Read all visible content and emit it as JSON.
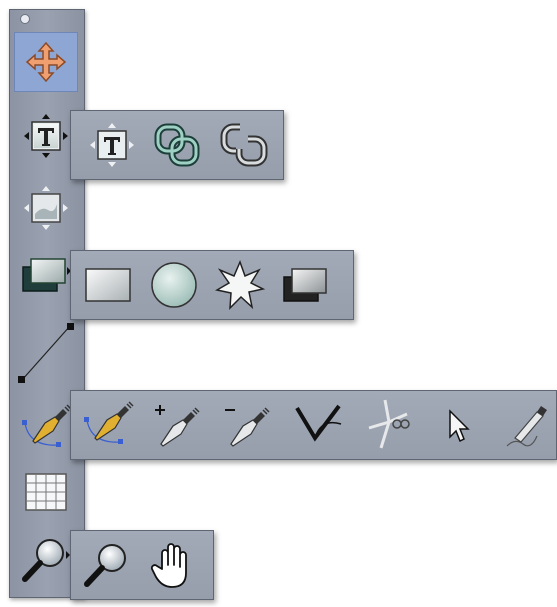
{
  "colors": {
    "toolbar_bg": "#9aa2b1",
    "flyout_bg": "#9ca4b2",
    "selected_bg": "#8ea6d4",
    "move_arrow": "#f0a070",
    "shape_fill": "#cbd6d6"
  },
  "toolbar": {
    "tools": [
      {
        "name": "move-tool",
        "icon": "four-way-arrow-icon",
        "selected": true
      },
      {
        "name": "text-box-tool",
        "icon": "text-box-icon",
        "has_flyout": true
      },
      {
        "name": "picture-box-tool",
        "icon": "picture-box-icon"
      },
      {
        "name": "shape-tool",
        "icon": "shape-stack-icon",
        "has_flyout": true
      },
      {
        "name": "line-tool",
        "icon": "line-icon"
      },
      {
        "name": "bezier-pen-tool",
        "icon": "pen-icon",
        "has_flyout": true
      },
      {
        "name": "table-tool",
        "icon": "table-icon"
      },
      {
        "name": "zoom-tool",
        "icon": "magnifier-icon",
        "has_flyout": true
      }
    ]
  },
  "flyouts": {
    "text": [
      "text-box-icon",
      "link-icon",
      "unlink-icon"
    ],
    "shapes": [
      "rectangle-icon",
      "oval-icon",
      "starburst-icon",
      "composition-zone-icon"
    ],
    "pen": [
      "bezier-pen-icon",
      "add-point-icon",
      "remove-point-icon",
      "convert-point-icon",
      "scissors-icon",
      "select-point-icon",
      "freehand-pen-icon"
    ],
    "zoom": [
      "magnifier-icon",
      "hand-icon"
    ]
  }
}
